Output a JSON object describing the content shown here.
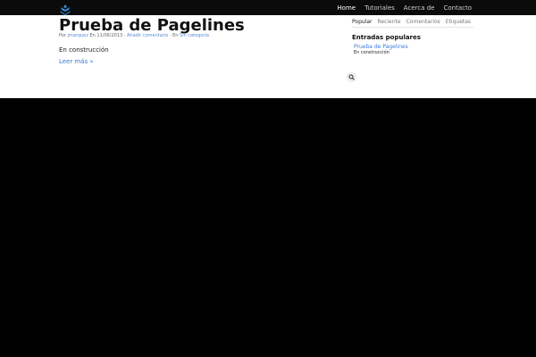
{
  "nav": {
    "items": [
      {
        "label": "Home",
        "active": true
      },
      {
        "label": "Tutoriales",
        "active": false
      },
      {
        "label": "Acerca de",
        "active": false
      },
      {
        "label": "Contacto",
        "active": false
      }
    ]
  },
  "post": {
    "title": "Prueba de Pagelines",
    "meta": {
      "by": "Por",
      "author": "jmarquez",
      "on": "En 11/06/2013",
      "sep1": "·",
      "comment": "Añadir comentario",
      "sep2": "·",
      "in": "En",
      "category": "Sin categoría"
    },
    "excerpt": "En construcción",
    "read_more": "Leer más »"
  },
  "sidebar": {
    "tabs": [
      {
        "label": "Popular",
        "active": true
      },
      {
        "label": "Reciente",
        "active": false
      },
      {
        "label": "Comentarios",
        "active": false
      },
      {
        "label": "Etiquetas",
        "active": false
      }
    ],
    "heading": "Entradas populares",
    "popular_link": "Prueba de Pagelines",
    "popular_sub": "En construcción"
  },
  "colors": {
    "accent": "#3b7ad8",
    "topbar": "#0b0b0b",
    "background": "#000000"
  },
  "icons": {
    "logo": "pagelines-leaf-logo",
    "search": "search-icon"
  }
}
